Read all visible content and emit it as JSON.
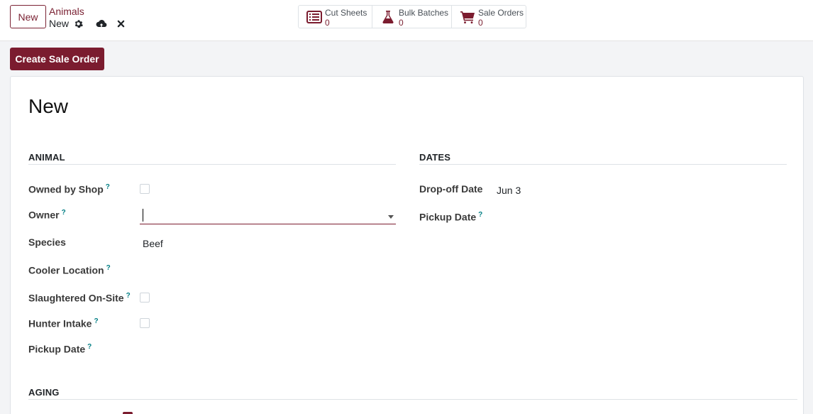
{
  "topbar": {
    "new_label": "New",
    "breadcrumb_parent": "Animals",
    "breadcrumb_current": "New"
  },
  "smart_buttons": [
    {
      "label": "Cut Sheets",
      "count": "0",
      "icon": "list-icon"
    },
    {
      "label": "Bulk Batches",
      "count": "0",
      "icon": "flask-icon"
    },
    {
      "label": "Sale Orders",
      "count": "0",
      "icon": "cart-icon"
    }
  ],
  "actions": {
    "create_sale_order": "Create Sale Order"
  },
  "record": {
    "title": "New"
  },
  "animal": {
    "section_title": "ANIMAL",
    "owned_by_shop_label": "Owned by Shop",
    "owner_label": "Owner",
    "owner_value": "",
    "species_label": "Species",
    "species_value": "Beef",
    "cooler_location_label": "Cooler Location",
    "slaughtered_onsite_label": "Slaughtered On-Site",
    "hunter_intake_label": "Hunter Intake",
    "pickup_date_label": "Pickup Date"
  },
  "dates": {
    "section_title": "DATES",
    "dropoff_label": "Drop-off Date",
    "dropoff_value": "Jun 3",
    "pickup_label": "Pickup Date"
  },
  "aging": {
    "section_title": "AGING"
  },
  "help_mark": "?",
  "colors": {
    "brand": "#7b1c2f",
    "help": "#017e84"
  }
}
